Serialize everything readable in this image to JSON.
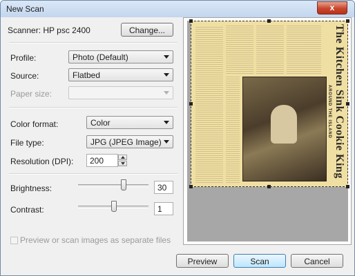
{
  "window": {
    "title": "New Scan",
    "close_label": "x"
  },
  "scanner": {
    "label": "Scanner: HP psc 2400",
    "change_button": "Change..."
  },
  "form": {
    "profile": {
      "label": "Profile:",
      "value": "Photo (Default)"
    },
    "source": {
      "label": "Source:",
      "value": "Flatbed"
    },
    "paper_size": {
      "label": "Paper size:",
      "value": ""
    },
    "color_format": {
      "label": "Color format:",
      "value": "Color"
    },
    "file_type": {
      "label": "File type:",
      "value": "JPG (JPEG Image)"
    },
    "resolution": {
      "label": "Resolution (DPI):",
      "value": "200"
    },
    "brightness": {
      "label": "Brightness:",
      "value": "30",
      "min": -100,
      "max": 100
    },
    "contrast": {
      "label": "Contrast:",
      "value": "1",
      "min": -100,
      "max": 100
    },
    "separate_files": {
      "label": "Preview or scan images as separate files",
      "checked": false
    }
  },
  "preview": {
    "headline": "The Kitchen Sink Cookie King",
    "subhead": "AROUND THE ISLAND"
  },
  "buttons": {
    "preview": "Preview",
    "scan": "Scan",
    "cancel": "Cancel"
  }
}
